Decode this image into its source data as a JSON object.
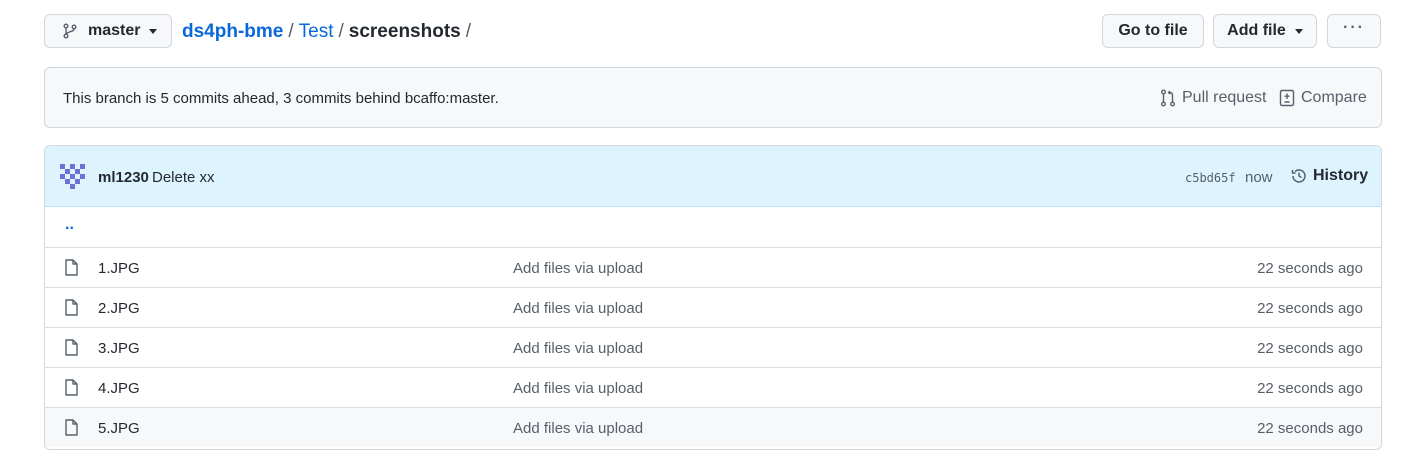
{
  "header": {
    "branch": "master",
    "breadcrumb": {
      "repo": "ds4ph-bme",
      "folder": "Test",
      "current": "screenshots",
      "sep": "/"
    },
    "goto_file": "Go to file",
    "add_file": "Add file",
    "more": "···"
  },
  "branch_info": {
    "message": "This branch is 5 commits ahead, 3 commits behind bcaffo:master.",
    "pull_request": "Pull request",
    "compare": "Compare"
  },
  "commit": {
    "author": "ml1230",
    "message": "Delete xx",
    "sha": "c5bd65f",
    "time": "now",
    "history": "History"
  },
  "files": {
    "updir": "..",
    "rows": [
      {
        "name": "1.JPG",
        "message": "Add files via upload",
        "time": "22 seconds ago"
      },
      {
        "name": "2.JPG",
        "message": "Add files via upload",
        "time": "22 seconds ago"
      },
      {
        "name": "3.JPG",
        "message": "Add files via upload",
        "time": "22 seconds ago"
      },
      {
        "name": "4.JPG",
        "message": "Add files via upload",
        "time": "22 seconds ago"
      },
      {
        "name": "5.JPG",
        "message": "Add files via upload",
        "time": "22 seconds ago"
      }
    ]
  },
  "icons": {
    "branch": "git-branch-icon",
    "pull": "git-pull-request-icon",
    "compare": "file-diff-icon",
    "history": "history-icon",
    "file": "file-icon"
  },
  "colors": {
    "link": "#0969da",
    "commit_bar": "#ddf4ff",
    "border": "#d0d7de"
  }
}
